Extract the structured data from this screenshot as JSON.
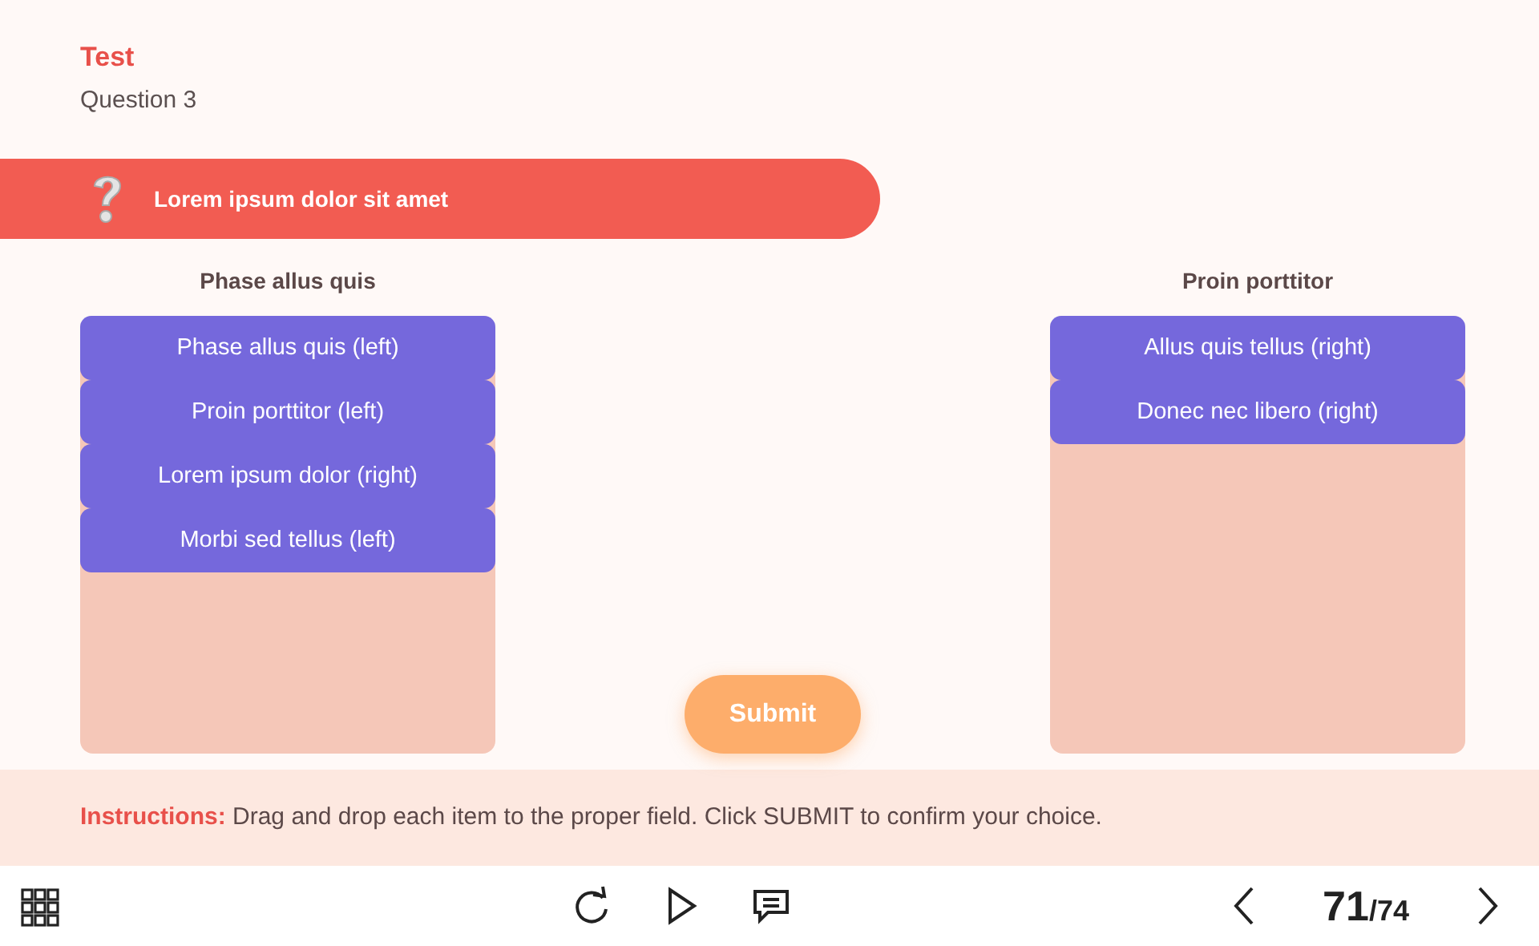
{
  "header": {
    "title": "Test",
    "subtitle": "Question 3"
  },
  "question": {
    "text": "Lorem ipsum dolor sit amet"
  },
  "zones": [
    {
      "heading": "Phase allus quis",
      "items": [
        "Phase allus quis (left)",
        "Proin porttitor (left)",
        "Lorem ipsum dolor (right)",
        "Morbi sed tellus (left)"
      ]
    },
    {
      "heading": "Proin porttitor",
      "items": [
        "Allus quis tellus (right)",
        "Donec nec libero (right)"
      ]
    }
  ],
  "submit": "Submit",
  "instructions": "**Instructions:** Drag and drop each item to the proper field. Click SUBMIT to confirm your choice.",
  "pager": {
    "current": "71",
    "total": "/74"
  }
}
